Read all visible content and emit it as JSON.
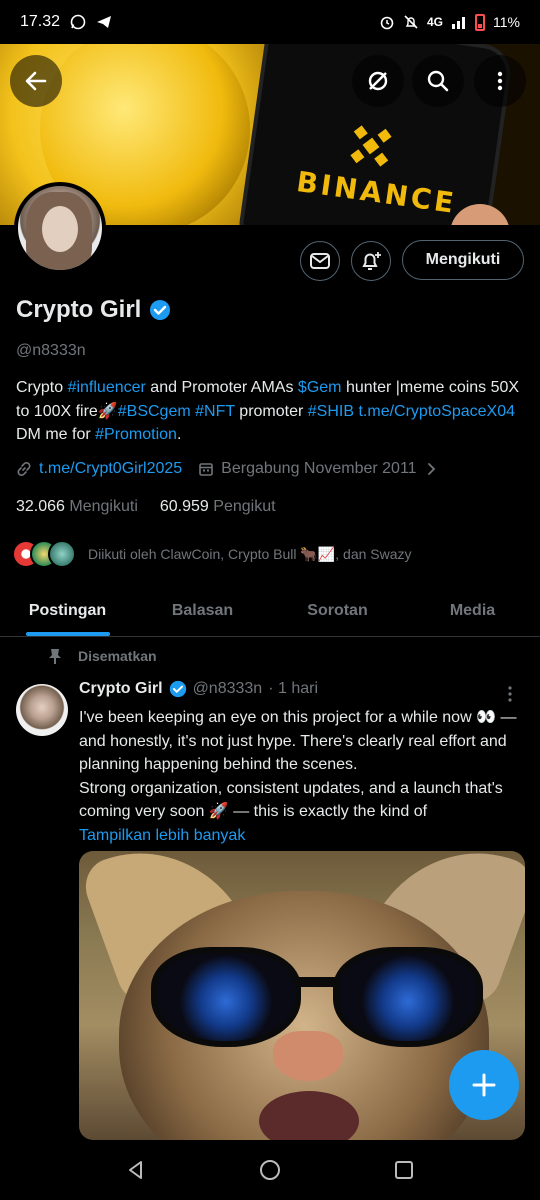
{
  "status_bar": {
    "time": "17.32",
    "network": "4G",
    "battery": "11%"
  },
  "banner": {
    "brand_text": "BINANCE"
  },
  "profile": {
    "name": "Crypto Girl",
    "handle": "@n8333n",
    "follow_button": "Mengikuti",
    "bio": [
      {
        "t": "Crypto ",
        "link": false
      },
      {
        "t": "#influencer",
        "link": true
      },
      {
        "t": " and Promoter AMAs ",
        "link": false
      },
      {
        "t": "$Gem",
        "link": true
      },
      {
        "t": " hunter |meme coins 50X to 100X fire🚀",
        "link": false
      },
      {
        "t": "#BSCgem",
        "link": true
      },
      {
        "t": " ",
        "link": false
      },
      {
        "t": "#NFT",
        "link": true
      },
      {
        "t": " promoter ",
        "link": false
      },
      {
        "t": "#SHIB",
        "link": true
      },
      {
        "t": " ",
        "link": false
      },
      {
        "t": "t.me/CryptoSpaceX04",
        "link": true
      },
      {
        "t": " DM me for ",
        "link": false
      },
      {
        "t": "#Promotion",
        "link": true
      },
      {
        "t": ".",
        "link": false
      }
    ],
    "website": "t.me/Crypt0Girl2025",
    "joined": "Bergabung November 2011",
    "following_count": "32.066",
    "following_label": "Mengikuti",
    "followers_count": "60.959",
    "followers_label": "Pengikut",
    "followed_by": "Diikuti oleh ClawCoin, Crypto Bull 🐂📈, dan Swazy"
  },
  "tabs": [
    {
      "label": "Postingan",
      "active": true
    },
    {
      "label": "Balasan",
      "active": false
    },
    {
      "label": "Sorotan",
      "active": false
    },
    {
      "label": "Media",
      "active": false
    }
  ],
  "tweet": {
    "pinned_label": "Disematkan",
    "author_name": "Crypto Girl",
    "author_handle": "@n8333n",
    "time": "· 1 hari",
    "text": "I've been keeping an eye on this project for a while now 👀 — and honestly, it's not just hype. There's clearly real effort and planning happening behind the scenes.\nStrong organization, consistent updates, and a launch that's coming very soon 🚀 — this is exactly the kind of",
    "show_more": "Tampilkan lebih banyak"
  },
  "colors": {
    "accent": "#1d9bf0",
    "muted": "#71767b",
    "text": "#e7e9ea",
    "background": "#000000"
  },
  "icons": [
    "back-arrow-icon",
    "hide-icon",
    "search-icon",
    "more-vertical-icon",
    "message-icon",
    "notification-add-icon",
    "verified-icon",
    "link-icon",
    "calendar-icon",
    "chevron-right-icon",
    "pin-icon",
    "compose-plus-icon",
    "nav-back-icon",
    "nav-home-icon",
    "nav-recents-icon"
  ]
}
